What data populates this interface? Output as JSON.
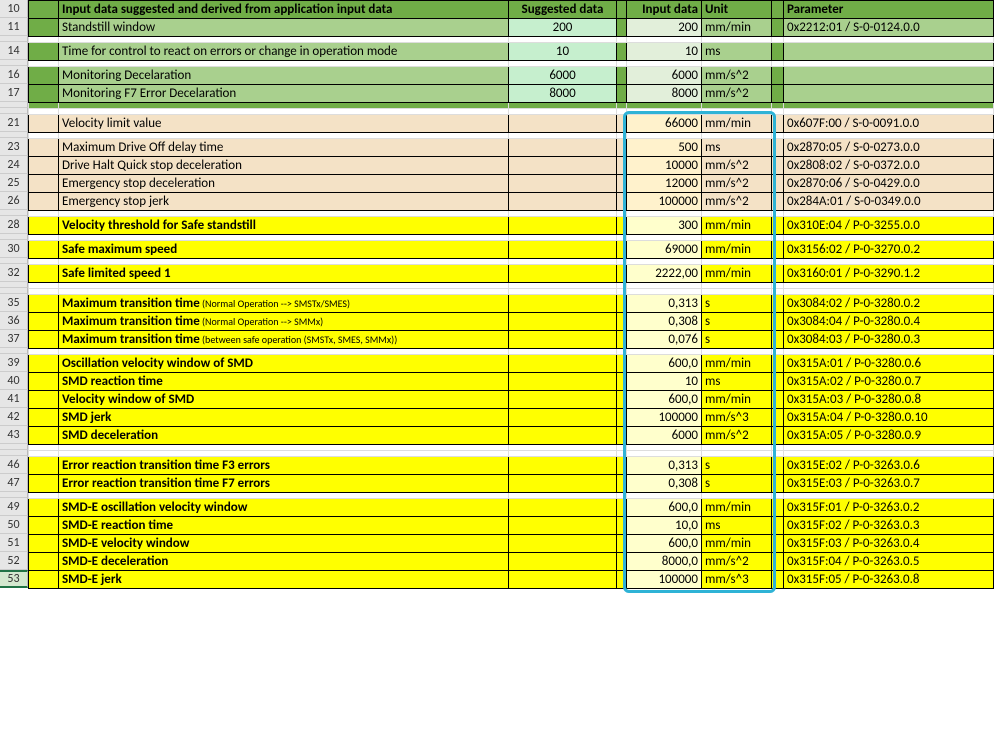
{
  "row_numbers": [
    "10",
    "11",
    "",
    "14",
    "",
    "16",
    "17",
    "",
    "",
    "21",
    "",
    "23",
    "24",
    "25",
    "26",
    "",
    "28",
    "",
    "30",
    "",
    "32",
    "",
    "35",
    "36",
    "37",
    "",
    "39",
    "40",
    "41",
    "42",
    "43",
    "",
    "46",
    "47",
    "",
    "49",
    "50",
    "51",
    "52",
    "53"
  ],
  "row_numbers_display": {
    "10": "10",
    "11": "11",
    "14": "14",
    "16": "16",
    "17": "17",
    "21": "21",
    "23": "23",
    "24": "24",
    "25": "25",
    "26": "26",
    "28": "28",
    "30": "30",
    "32": "32",
    "35": "35",
    "36": "36",
    "37": "37",
    "39": "39",
    "40": "40",
    "41": "41",
    "42": "42",
    "43": "43",
    "46": "46",
    "47": "47",
    "49": "49",
    "50": "50",
    "51": "51",
    "52": "52",
    "53": "53"
  },
  "header": {
    "label": "Input data suggested and derived from application input data",
    "suggested": "Suggested data",
    "input": "Input data",
    "unit": "Unit",
    "param": "Parameter"
  },
  "rows_green": [
    {
      "rn": "11",
      "label": "Standstill window",
      "sugg": "200",
      "val": "200",
      "unit": "mm/min",
      "param": "0x2212:01 / S-0-0124.0.0"
    },
    {
      "rn": "14",
      "label": "Time for control to react on errors or change in operation mode",
      "sugg": "10",
      "val": "10",
      "unit": "ms",
      "param": ""
    },
    {
      "rn": "16",
      "label": "Monitoring Decelaration",
      "sugg": "6000",
      "val": "6000",
      "unit": "mm/s^2",
      "param": ""
    },
    {
      "rn": "17",
      "label": "Monitoring F7 Error Decelaration",
      "sugg": "8000",
      "val": "8000",
      "unit": "mm/s^2",
      "param": ""
    }
  ],
  "rows_tan": [
    {
      "rn": "21",
      "label": "Velocity limit value",
      "val": "66000",
      "unit": "mm/min",
      "param": "0x607F:00 / S-0-0091.0.0"
    },
    {
      "rn": "23",
      "label": "Maximum Drive Off delay time",
      "val": "500",
      "unit": "ms",
      "param": "0x2870:05 / S-0-0273.0.0"
    },
    {
      "rn": "24",
      "label": "Drive Halt Quick stop deceleration",
      "val": "10000",
      "unit": "mm/s^2",
      "param": "0x2808:02 / S-0-0372.0.0"
    },
    {
      "rn": "25",
      "label": "Emergency stop deceleration",
      "val": "12000",
      "unit": "mm/s^2",
      "param": "0x2870:06 / S-0-0429.0.0"
    },
    {
      "rn": "26",
      "label": "Emergency stop jerk",
      "val": "100000",
      "unit": "mm/s^2",
      "param": "0x284A:01 / S-0-0349.0.0"
    }
  ],
  "rows_yellow": [
    {
      "rn": "28",
      "label": "Velocity threshold for Safe standstill",
      "val": "300",
      "unit": "mm/min",
      "param": "0x310E:04 / P-0-3255.0.0"
    },
    {
      "rn": "30",
      "label": "Safe maximum speed",
      "val": "69000",
      "unit": "mm/min",
      "param": "0x3156:02 / P-0-3270.0.2"
    },
    {
      "rn": "32",
      "label": "Safe limited speed 1",
      "val": "2222,00",
      "unit": "mm/min",
      "param": "0x3160:01 / P-0-3290.1.2"
    },
    {
      "rn": "35",
      "label": "Maximum transition time",
      "note": "(Normal Operation --> SMSTx/SMES)",
      "val": "0,313",
      "unit": "s",
      "param": "0x3084:02 / P-0-3280.0.2"
    },
    {
      "rn": "36",
      "label": "Maximum transition time",
      "note": "(Normal Operation --> SMMx)",
      "val": "0,308",
      "unit": "s",
      "param": "0x3084:04 / P-0-3280.0.4"
    },
    {
      "rn": "37",
      "label": "Maximum transition time",
      "note": "(between safe operation (SMSTx, SMES, SMMx))",
      "val": "0,076",
      "unit": "s",
      "param": "0x3084:03 / P-0-3280.0.3"
    },
    {
      "rn": "39",
      "label": "Oscillation velocity window of SMD",
      "val": "600,0",
      "unit": "mm/min",
      "param": "0x315A:01 / P-0-3280.0.6"
    },
    {
      "rn": "40",
      "label": "SMD reaction time",
      "val": "10",
      "unit": "ms",
      "param": "0x315A:02 / P-0-3280.0.7"
    },
    {
      "rn": "41",
      "label": "Velocity window of SMD",
      "val": "600,0",
      "unit": "mm/min",
      "param": "0x315A:03 / P-0-3280.0.8"
    },
    {
      "rn": "42",
      "label": "SMD jerk",
      "val": "100000",
      "unit": "mm/s^3",
      "param": "0x315A:04 / P-0-3280.0.10"
    },
    {
      "rn": "43",
      "label": "SMD deceleration",
      "val": "6000",
      "unit": "mm/s^2",
      "param": "0x315A:05 / P-0-3280.0.9"
    },
    {
      "rn": "46",
      "label": "Error reaction transition time F3 errors",
      "val": "0,313",
      "unit": "s",
      "param": "0x315E:02 / P-0-3263.0.6"
    },
    {
      "rn": "47",
      "label": "Error reaction transition time F7 errors",
      "val": "0,308",
      "unit": "s",
      "param": "0x315E:03 / P-0-3263.0.7"
    },
    {
      "rn": "49",
      "label": "SMD-E oscillation velocity window",
      "val": "600,0",
      "unit": "mm/min",
      "param": "0x315F:01 / P-0-3263.0.2"
    },
    {
      "rn": "50",
      "label": "SMD-E reaction time",
      "val": "10,0",
      "unit": "ms",
      "param": "0x315F:02 / P-0-3263.0.3"
    },
    {
      "rn": "51",
      "label": "SMD-E velocity window",
      "val": "600,0",
      "unit": "mm/min",
      "param": "0x315F:03 / P-0-3263.0.4"
    },
    {
      "rn": "52",
      "label": "SMD-E deceleration",
      "val": "8000,0",
      "unit": "mm/s^2",
      "param": "0x315F:04 / P-0-3263.0.5"
    },
    {
      "rn": "53",
      "label": "SMD-E jerk",
      "val": "100000",
      "unit": "mm/s^3",
      "param": "0x315F:05 / P-0-3263.0.8"
    }
  ]
}
